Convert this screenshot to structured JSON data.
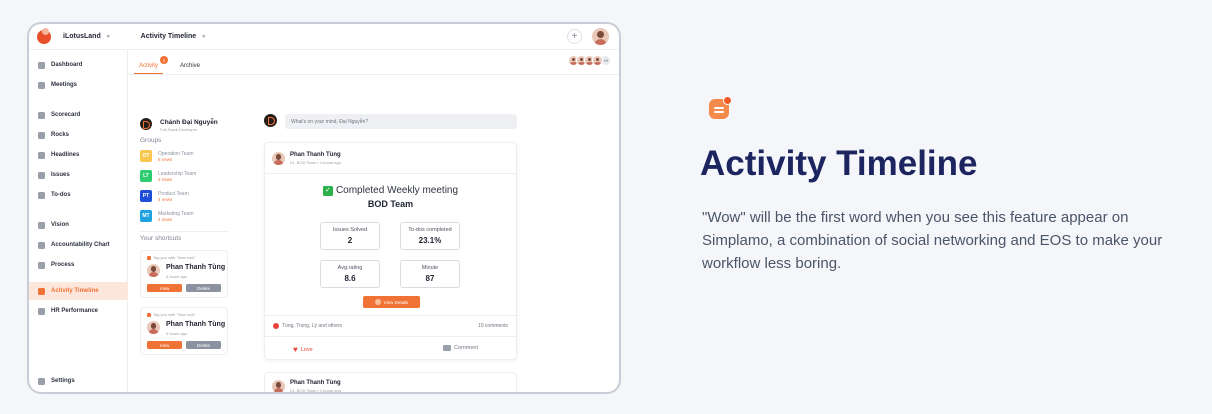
{
  "app": {
    "org_name": "iLotusLand",
    "breadcrumb": "Activity Timeline",
    "add_label": "+"
  },
  "sidebar": {
    "items": [
      {
        "label": "Dashboard",
        "icon": "dashboard-icon"
      },
      {
        "label": "Meetings",
        "icon": "meetings-icon"
      },
      {
        "label": "Scorecard",
        "icon": "scorecard-icon"
      },
      {
        "label": "Rocks",
        "icon": "rocks-icon"
      },
      {
        "label": "Headlines",
        "icon": "headlines-icon"
      },
      {
        "label": "Issues",
        "icon": "issues-icon"
      },
      {
        "label": "To-dos",
        "icon": "todos-icon"
      },
      {
        "label": "Vision",
        "icon": "vision-icon"
      },
      {
        "label": "Accountability Chart",
        "icon": "chart-icon"
      },
      {
        "label": "Process",
        "icon": "process-icon"
      },
      {
        "label": "Activity Timeline",
        "icon": "timeline-icon",
        "active": true
      },
      {
        "label": "HR Performance",
        "icon": "hr-icon"
      },
      {
        "label": "Settings",
        "icon": "settings-icon"
      }
    ]
  },
  "tabs": [
    {
      "label": "Activity",
      "badge": "3",
      "active": true
    },
    {
      "label": "Archive"
    }
  ],
  "team_stack_more": "+9",
  "profile": {
    "name": "Chánh Đại Nguyễn",
    "role": "Full-Stack Developer"
  },
  "groups_title": "Groups",
  "groups": [
    {
      "abbr": "OT",
      "name": "Operation Team",
      "news": "5 news",
      "color": "#f9c74f"
    },
    {
      "abbr": "LT",
      "name": "Leadership Team",
      "news": "3 news",
      "color": "#2ecc71"
    },
    {
      "abbr": "PT",
      "name": "Product Team",
      "news": "4 news",
      "color": "#1e4fd8"
    },
    {
      "abbr": "MT",
      "name": "Marketing Team",
      "news": "4 news",
      "color": "#1fa2e0"
    }
  ],
  "shortcuts_title": "Your shortcuts",
  "shortcuts": [
    {
      "tag": "Tag you with \"New rock\"",
      "name": "Phan Thanh Tùng",
      "time": "4 hours ago",
      "view": "View",
      "delete": "Delete"
    },
    {
      "tag": "Tag you with \"New rock\"",
      "name": "Phan Thanh Tùng",
      "time": "4 hours ago",
      "view": "View",
      "delete": "Delete"
    }
  ],
  "composer": {
    "placeholder": "What's on your mind, Đại Nguyễn?"
  },
  "post": {
    "author": "Phan Thanh Tùng",
    "team": "01. BOD Team",
    "time": "4 hours ago",
    "title": "Completed Weekly meeting",
    "team_name": "BOD Team",
    "stats": [
      {
        "label": "Issues Solved",
        "value": "2"
      },
      {
        "label": "To-dos completed",
        "value": "23.1%"
      },
      {
        "label": "Avg.rating",
        "value": "8.6"
      },
      {
        "label": "Minute",
        "value": "87"
      }
    ],
    "details_button": "View Details",
    "reactions": "Tùng, Trọng, Lý and others",
    "comments_count": "10 comments",
    "love_label": "Love",
    "comment_label": "Comment"
  },
  "post2": {
    "author": "Phan Thanh Tùng",
    "team": "01. BOD Team",
    "time": "4 hours ago"
  },
  "feature": {
    "title": "Activity Timeline",
    "description": "\"Wow\" will be the first word when you see this feature appear on Simplamo, a combination of social networking and EOS to make your workflow less boring."
  },
  "colors": {
    "accent": "#f07235",
    "headline": "#1c2560"
  }
}
